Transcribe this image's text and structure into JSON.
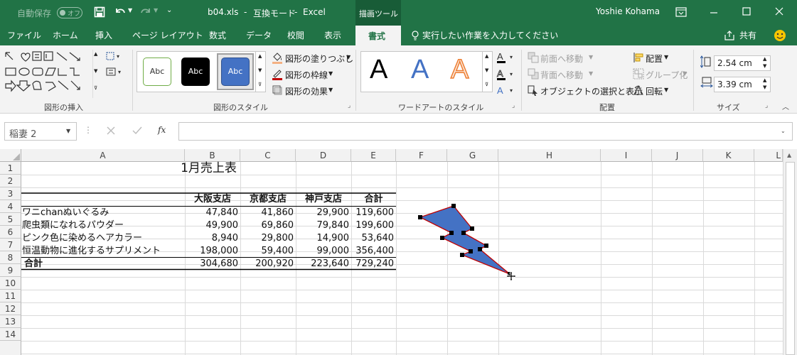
{
  "titlebar": {
    "autosave_label": "自動保存",
    "autosave_state": "オフ",
    "filename": "b04.xls",
    "mode": "互換モード",
    "app": "Excel",
    "sep": "-",
    "contextual_group": "描画ツール",
    "user": "Yoshie Kohama"
  },
  "tabs": [
    "ファイル",
    "ホーム",
    "挿入",
    "ページ レイアウト",
    "数式",
    "データ",
    "校閲",
    "表示",
    "書式"
  ],
  "tell_me": "実行したい作業を入力してください",
  "share": "共有",
  "ribbon": {
    "insert_shapes_label": "図形の挿入",
    "shape_styles_label": "図形のスタイル",
    "style_samples": [
      "Abc",
      "Abc",
      "Abc"
    ],
    "fill": "図形の塗りつぶし",
    "outline": "図形の枠線",
    "effects": "図形の効果",
    "wordart_label": "ワードアートのスタイル",
    "wordart_sample": "A",
    "bring_forward": "前面へ移動",
    "send_backward": "背面へ移動",
    "selection_pane": "オブジェクトの選択と表示",
    "align": "配置",
    "group": "グループ化",
    "rotate": "回転",
    "arrange_label": "配置",
    "height": "2.54 cm",
    "width": "3.39 cm",
    "size_label": "サイズ"
  },
  "formula": {
    "name_box": "稲妻 2",
    "fx": "fx",
    "value": ""
  },
  "columns": [
    "A",
    "B",
    "C",
    "D",
    "E",
    "F",
    "G",
    "H",
    "I",
    "J",
    "K",
    "L"
  ],
  "rows": [
    "1",
    "2",
    "3",
    "4",
    "5",
    "6",
    "7",
    "8",
    "9",
    "10",
    "11",
    "12",
    "13",
    "14"
  ],
  "sheet": {
    "title": "1月売上表",
    "headers": [
      "大阪支店",
      "京都支店",
      "神戸支店",
      "合計"
    ],
    "data": [
      [
        "ワニchanぬいぐるみ",
        "47,840",
        "41,860",
        "29,900",
        "119,600"
      ],
      [
        "爬虫類になれるパウダー",
        "49,900",
        "69,860",
        "79,840",
        "199,600"
      ],
      [
        "ピンク色に染めるヘアカラー",
        "8,940",
        "29,800",
        "14,900",
        "53,640"
      ],
      [
        "恒温動物に進化するサプリメント",
        "198,000",
        "59,400",
        "99,000",
        "356,400"
      ],
      [
        "合計",
        "304,680",
        "200,920",
        "223,640",
        "729,240"
      ]
    ]
  },
  "colors": {
    "brand": "#217346",
    "shape_fill": "#4472c4",
    "shape_outline": "#c00000"
  }
}
